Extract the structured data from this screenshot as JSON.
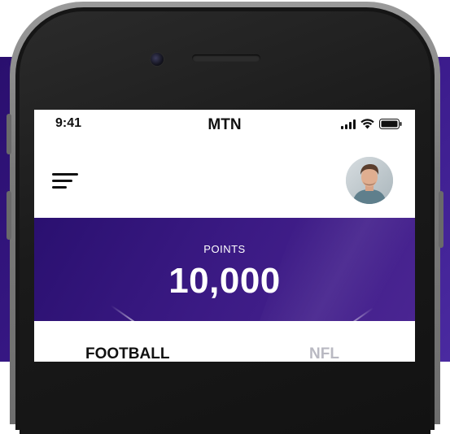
{
  "status_bar": {
    "time": "9:41",
    "carrier": "MTN",
    "icons": [
      "signal-icon",
      "wifi-icon",
      "battery-icon"
    ]
  },
  "header": {
    "menu_icon": "menu-icon",
    "avatar": "user-avatar"
  },
  "points": {
    "label": "POINTS",
    "value": "10,000"
  },
  "tabs": [
    {
      "label": "FOOTBALL",
      "active": true
    },
    {
      "label": "NFL",
      "active": false
    }
  ],
  "colors": {
    "brand_purple": "#3b1a84",
    "text_dark": "#111111",
    "tab_inactive": "#b9b9c2"
  }
}
